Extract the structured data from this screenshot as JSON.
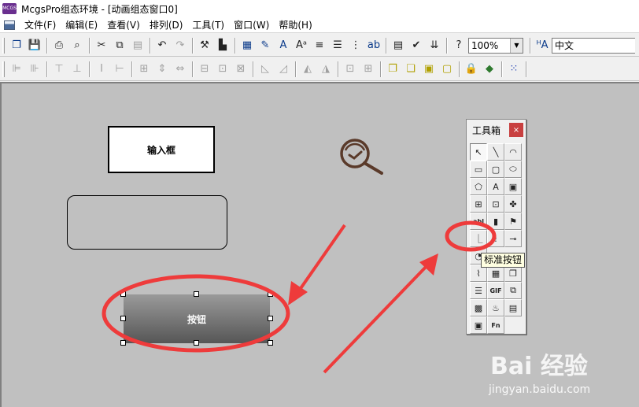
{
  "window": {
    "app_icon_text": "MCGS",
    "title": "McgsPro组态环境 - [动画组态窗口0]"
  },
  "menu": [
    "文件(F)",
    "编辑(E)",
    "查看(V)",
    "排列(D)",
    "工具(T)",
    "窗口(W)",
    "帮助(H)"
  ],
  "toolbar": {
    "zoom_value": "100%",
    "language_value": "中文"
  },
  "canvas": {
    "input_box_label": "输入框",
    "button_label": "按钮"
  },
  "toolbox": {
    "title": "工具箱",
    "close_glyph": "×",
    "tools": [
      {
        "name": "pointer-tool",
        "glyph": "↖",
        "selected": true
      },
      {
        "name": "line-tool",
        "glyph": "╲"
      },
      {
        "name": "arc-tool",
        "glyph": "◠"
      },
      {
        "name": "rectangle-tool",
        "glyph": "▭"
      },
      {
        "name": "rounded-rectangle-tool",
        "glyph": "▢"
      },
      {
        "name": "ellipse-tool",
        "glyph": "⬭"
      },
      {
        "name": "polygon-tool",
        "glyph": "⬠"
      },
      {
        "name": "text-label-tool",
        "glyph": "A"
      },
      {
        "name": "bitmap-tool",
        "glyph": "▣"
      },
      {
        "name": "pipe-tool",
        "glyph": "⊞"
      },
      {
        "name": "flow-block-tool",
        "glyph": "⊡"
      },
      {
        "name": "symbol-library-tool",
        "glyph": "✤"
      },
      {
        "name": "input-box-tool",
        "glyph": "abl"
      },
      {
        "name": "slider-tool",
        "glyph": "▮"
      },
      {
        "name": "alarm-light-tool",
        "glyph": "⚑"
      },
      {
        "name": "standard-button-tool",
        "glyph": "⎿"
      },
      {
        "name": "indicator-tool",
        "glyph": "!"
      },
      {
        "name": "key-tool",
        "glyph": "⊸"
      },
      {
        "name": "gauge-tool",
        "glyph": "◔"
      },
      {
        "name": "hidden-tool-1",
        "glyph": ""
      },
      {
        "name": "hidden-tool-2",
        "glyph": ""
      },
      {
        "name": "trend-curve-tool",
        "glyph": "⌇"
      },
      {
        "name": "table-tool",
        "glyph": "▦"
      },
      {
        "name": "window-tool",
        "glyph": "❐"
      },
      {
        "name": "report-tool",
        "glyph": "☰"
      },
      {
        "name": "gif-tool",
        "glyph": "GIF"
      },
      {
        "name": "frame-tool",
        "glyph": "⧉"
      },
      {
        "name": "qrcode-tool",
        "glyph": "▩"
      },
      {
        "name": "alarm-bell-tool",
        "glyph": "♨"
      },
      {
        "name": "alarm-display-tool",
        "glyph": "▤"
      },
      {
        "name": "image-tool",
        "glyph": "▣"
      },
      {
        "name": "function-tool",
        "glyph": "Fn"
      }
    ],
    "tooltip": "标准按钮"
  },
  "watermark": {
    "logo": "Bai 经验",
    "url": "jingyan.baidu.com"
  }
}
